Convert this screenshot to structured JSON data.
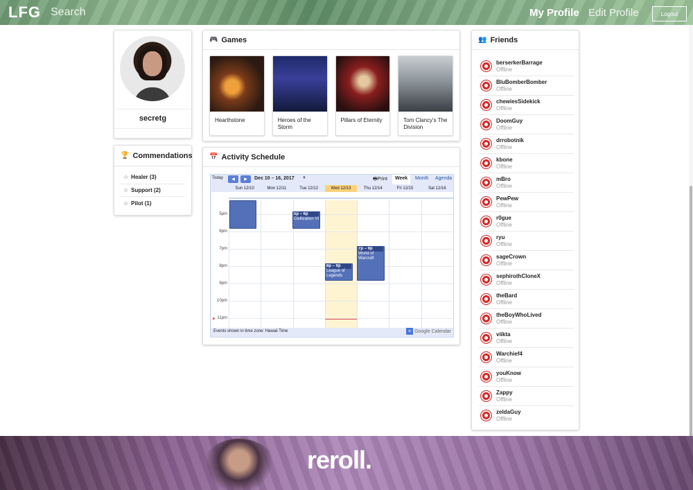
{
  "navbar": {
    "brand": "LFG",
    "search": "Search",
    "my_profile": "My Profile",
    "edit_profile": "Edit Profile",
    "logout": "Logout"
  },
  "profile": {
    "username": "secretg"
  },
  "commendations": {
    "title": "Commendations",
    "icon": "trophy-icon",
    "items": [
      {
        "label": "Healer (3)",
        "icon": "star-outline-icon"
      },
      {
        "label": "Support (2)",
        "icon": "star-outline-icon"
      },
      {
        "label": "Pilot (1)",
        "icon": "star-outline-icon"
      }
    ]
  },
  "games": {
    "title": "Games",
    "icon": "gamepad-icon",
    "items": [
      {
        "title": "Hearthstone"
      },
      {
        "title": "Heroes of the Storm"
      },
      {
        "title": "Pillars of Eternity"
      },
      {
        "title": "Tom Clancy's The Division"
      }
    ]
  },
  "activity": {
    "title": "Activity Schedule",
    "icon": "calendar-icon",
    "calendar": {
      "today_label": "Today",
      "prev": "◀",
      "next": "▶",
      "range": "Dec 10 – 16, 2017",
      "print": "Print",
      "views": [
        "Week",
        "Month",
        "Agenda"
      ],
      "active_view": "Week",
      "days": [
        "Sun 12/10",
        "Mon 12/11",
        "Tue 12/12",
        "Wed 12/13",
        "Thu 12/14",
        "Fri 12/15",
        "Sat 12/16"
      ],
      "today_index": 3,
      "hours": [
        "5pm",
        "6pm",
        "7pm",
        "8pm",
        "9pm",
        "10pm",
        "11pm"
      ],
      "events": [
        {
          "day": 0,
          "time": "",
          "title": ""
        },
        {
          "day": 2,
          "time": "5p – 6p",
          "title": "Civilization VI"
        },
        {
          "day": 4,
          "time": "7p – 9p",
          "title": "World of Warcraft"
        },
        {
          "day": 3,
          "time": "8p – 9p",
          "title": "League of Legends"
        }
      ],
      "timezone_note": "Events shown in time zone: Hawaii Time",
      "powered_by": "Google Calendar"
    }
  },
  "friends": {
    "title": "Friends",
    "icon": "users-icon",
    "items": [
      {
        "name": "berserkerBarrage",
        "status": "Offline"
      },
      {
        "name": "BluBomberBomber",
        "status": "Offline"
      },
      {
        "name": "chewiesSidekick",
        "status": "Offline"
      },
      {
        "name": "DoomGuy",
        "status": "Offline"
      },
      {
        "name": "drrobotnik",
        "status": "Offline"
      },
      {
        "name": "kbone",
        "status": "Offline"
      },
      {
        "name": "mBro",
        "status": "Offline"
      },
      {
        "name": "PewPew",
        "status": "Offline"
      },
      {
        "name": "r0gue",
        "status": "Offline"
      },
      {
        "name": "ryu",
        "status": "Offline"
      },
      {
        "name": "sageCrown",
        "status": "Offline"
      },
      {
        "name": "sephirothCloneX",
        "status": "Offline"
      },
      {
        "name": "theBard",
        "status": "Offline"
      },
      {
        "name": "theBoyWhoLived",
        "status": "Offline"
      },
      {
        "name": "viikta",
        "status": "Offline"
      },
      {
        "name": "Warchief4",
        "status": "Offline"
      },
      {
        "name": "youKnow",
        "status": "Offline"
      },
      {
        "name": "Zappy",
        "status": "Offline"
      },
      {
        "name": "zeldaGuy",
        "status": "Offline"
      }
    ]
  },
  "footer": {
    "logo": "reroll."
  },
  "colors": {
    "accent": "#5b7fd6",
    "event": "#5470b8",
    "friend_avatar": "#d42a2a",
    "today_column": "#fbd27a"
  }
}
